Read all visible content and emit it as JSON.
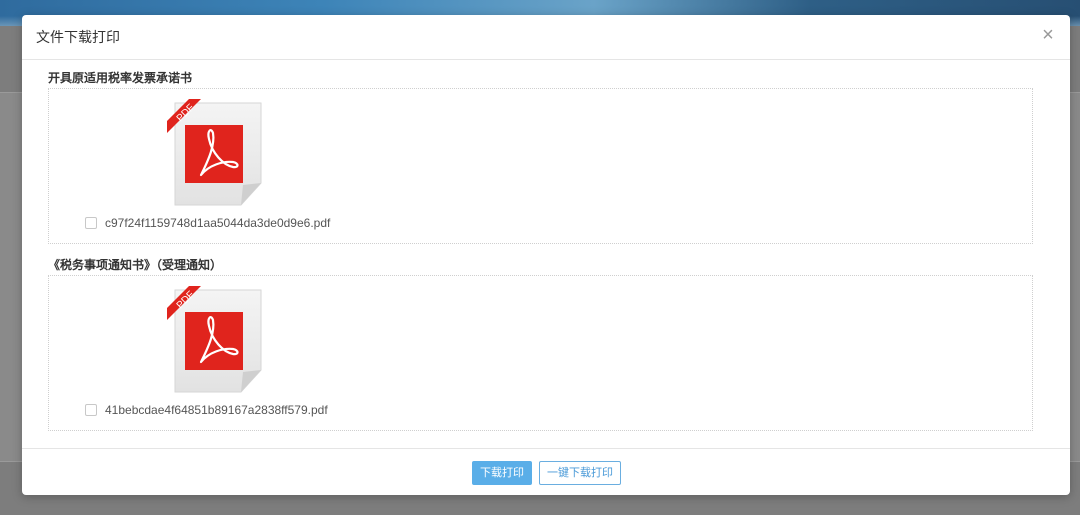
{
  "dialog": {
    "title": "文件下载打印",
    "close_glyph": "×"
  },
  "sections": [
    {
      "title": "开具原适用税率发票承诺书",
      "file_name": "c97f24f1159748d1aa5044da3de0d9e6.pdf",
      "icon_label": "PDF",
      "checked": false
    },
    {
      "title": "《税务事项通知书》（受理通知）",
      "file_name": "41bebcdae4f64851b89167a2838ff579.pdf",
      "icon_label": "PDF",
      "checked": false
    }
  ],
  "footer": {
    "download_print_label": "下载打印",
    "one_click_label": "一键下载打印"
  },
  "colors": {
    "primary": "#5aaee8",
    "pdf_red": "#e0241d",
    "banner_blue": "#3d84b8"
  }
}
